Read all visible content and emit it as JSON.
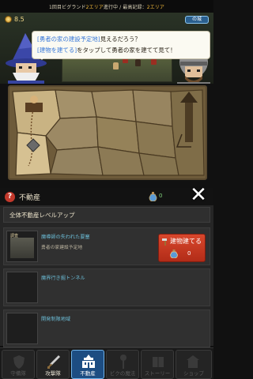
{
  "status_bar": {
    "prefix": "1回目ビグランド",
    "progress_label": "2エリア",
    "middle": "進行中 / 最高記録：",
    "record_label": "2エリア"
  },
  "hud": {
    "gold_value": "8.5",
    "chip_text": "の城"
  },
  "speech": {
    "line1_highlight": "[勇者の家の建設予定地]",
    "line1_rest": "見えるだろう？",
    "line2_highlight": "[建物を建てる]",
    "line2_rest": "をタップして勇者の家を建てて見て！"
  },
  "panel": {
    "help_icon": "?",
    "title": "不動産",
    "potion_count": "0",
    "close_icon": "✕",
    "level_up_all": "全体不動産レベルアップ"
  },
  "cards": [
    {
      "lv_badge": "調査",
      "title": "魔導師の失われた要塞",
      "subtitle": "勇者の家建設予定地",
      "build_button": {
        "label": "建物建てる",
        "cost": "0"
      }
    },
    {
      "title": "魔界行き掘トンネル",
      "subtitle": ""
    },
    {
      "title": "開発制限地域",
      "subtitle": ""
    }
  ],
  "bottom_nav": [
    {
      "label": "守備隊",
      "icon": "shield-icon",
      "state": "dim"
    },
    {
      "label": "攻撃隊",
      "icon": "sword-icon",
      "state": "bright"
    },
    {
      "label": "不動産",
      "icon": "building-icon",
      "state": "active"
    },
    {
      "label": "ビクの魔法",
      "icon": "magic-icon",
      "state": "dim"
    },
    {
      "label": "ストーリー",
      "icon": "book-icon",
      "state": "dim"
    },
    {
      "label": "ショップ",
      "icon": "shop-icon",
      "state": "dim"
    }
  ],
  "colors": {
    "accent_blue": "#3878d8",
    "build_red": "#c53a22",
    "active_tab": "#1d4d82",
    "card_title": "#6bbcd6",
    "potion_green": "#7fd07a"
  }
}
